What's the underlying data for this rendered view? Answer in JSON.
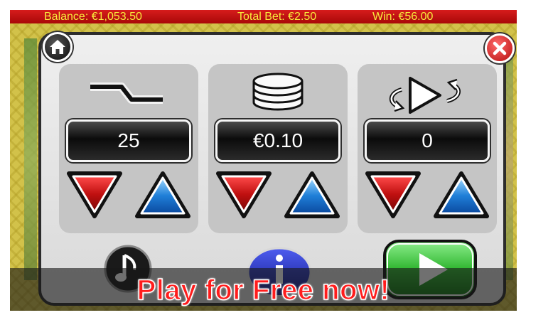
{
  "top_bar": {
    "balance": "Balance: €1,053.50",
    "total_bet": "Total Bet: €2.50",
    "win": "Win: €56.00"
  },
  "settings_panels": [
    {
      "name": "lines",
      "icon": "paylines-icon",
      "value": "25"
    },
    {
      "name": "coin_value",
      "icon": "coin-stack-icon",
      "value": "€0.10"
    },
    {
      "name": "autoplay",
      "icon": "autoplay-icon",
      "value": "0"
    }
  ],
  "buttons": {
    "home": "home-icon",
    "close": "close-icon",
    "sound": "music-note-icon",
    "info": "info-icon",
    "spin": "play-icon"
  },
  "banner": {
    "text": "Play for Free now!"
  },
  "colors": {
    "top_bar_bg": "#c41414",
    "top_bar_text": "#f8ec3c",
    "down_arrow": "#c01010",
    "up_arrow": "#1f7fd8",
    "spin_button": "#2fb52f",
    "banner_text": "#ff1c1c"
  }
}
